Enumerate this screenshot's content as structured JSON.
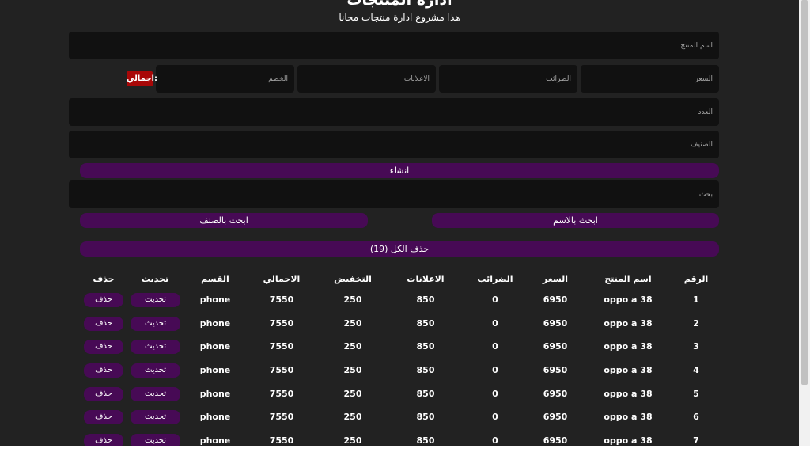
{
  "header": {
    "title": "ادارة المنتجات",
    "subtitle": "هذا مشروع ادارة منتجات مجانا"
  },
  "form": {
    "name_placeholder": "اسم المنتج",
    "price_placeholder": "السعر",
    "taxes_placeholder": "الضرائب",
    "ads_placeholder": "الاعلانات",
    "discount_placeholder": "الخصم",
    "total_label": "اجمالي:",
    "count_placeholder": "العدد",
    "category_placeholder": "الصنيف",
    "create_label": "انشاء"
  },
  "search": {
    "placeholder": "بحث",
    "by_name_label": "ابحث بالاسم",
    "by_category_label": "ابحث بالصنف",
    "delete_all_label": "حذف الكل (19)"
  },
  "table": {
    "headers": {
      "id": "الرقم",
      "name": "اسم المنتج",
      "price": "السعر",
      "taxes": "الضرائب",
      "ads": "الاعلانات",
      "discount": "التخفيض",
      "total": "الاجمالي",
      "category": "القسم",
      "update": "تحديث",
      "delete": "حذف"
    },
    "rows": [
      {
        "id": "1",
        "name": "oppo a 38",
        "price": "6950",
        "taxes": "0",
        "ads": "850",
        "discount": "250",
        "total": "7550",
        "category": "phone",
        "update": "تحديث",
        "delete": "حذف"
      },
      {
        "id": "2",
        "name": "oppo a 38",
        "price": "6950",
        "taxes": "0",
        "ads": "850",
        "discount": "250",
        "total": "7550",
        "category": "phone",
        "update": "تحديث",
        "delete": "حذف"
      },
      {
        "id": "3",
        "name": "oppo a 38",
        "price": "6950",
        "taxes": "0",
        "ads": "850",
        "discount": "250",
        "total": "7550",
        "category": "phone",
        "update": "تحديث",
        "delete": "حذف"
      },
      {
        "id": "4",
        "name": "oppo a 38",
        "price": "6950",
        "taxes": "0",
        "ads": "850",
        "discount": "250",
        "total": "7550",
        "category": "phone",
        "update": "تحديث",
        "delete": "حذف"
      },
      {
        "id": "5",
        "name": "oppo a 38",
        "price": "6950",
        "taxes": "0",
        "ads": "850",
        "discount": "250",
        "total": "7550",
        "category": "phone",
        "update": "تحديث",
        "delete": "حذف"
      },
      {
        "id": "6",
        "name": "oppo a 38",
        "price": "6950",
        "taxes": "0",
        "ads": "850",
        "discount": "250",
        "total": "7550",
        "category": "phone",
        "update": "تحديث",
        "delete": "حذف"
      },
      {
        "id": "7",
        "name": "oppo a 38",
        "price": "6950",
        "taxes": "0",
        "ads": "850",
        "discount": "250",
        "total": "7550",
        "category": "phone",
        "update": "تحديث",
        "delete": "حذف"
      }
    ]
  },
  "theme": {
    "background": "#222222",
    "input": "#111111",
    "accent_purple": "#470a55",
    "total_red": "#a80808"
  }
}
